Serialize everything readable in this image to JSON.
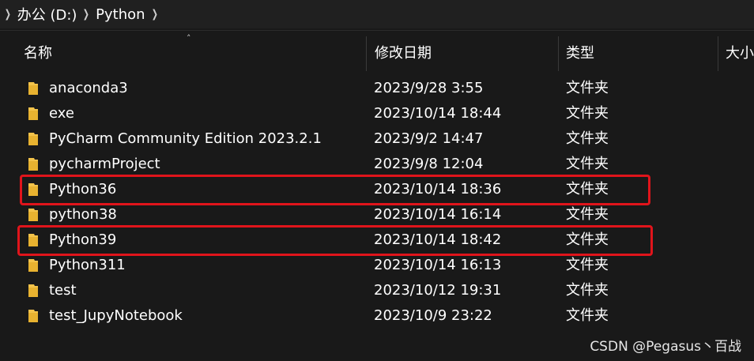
{
  "breadcrumb": {
    "items": [
      "办公 (D:)",
      "Python"
    ]
  },
  "columns": {
    "name": "名称",
    "modified": "修改日期",
    "type": "类型",
    "size": "大小"
  },
  "files": [
    {
      "name": "anaconda3",
      "modified": "2023/9/28 3:55",
      "type": "文件夹"
    },
    {
      "name": "exe",
      "modified": "2023/10/14 18:44",
      "type": "文件夹"
    },
    {
      "name": "PyCharm Community Edition 2023.2.1",
      "modified": "2023/9/2 14:47",
      "type": "文件夹"
    },
    {
      "name": "pycharmProject",
      "modified": "2023/9/8 12:04",
      "type": "文件夹"
    },
    {
      "name": "Python36",
      "modified": "2023/10/14 18:36",
      "type": "文件夹"
    },
    {
      "name": "python38",
      "modified": "2023/10/14 16:14",
      "type": "文件夹"
    },
    {
      "name": "Python39",
      "modified": "2023/10/14 18:42",
      "type": "文件夹"
    },
    {
      "name": "Python311",
      "modified": "2023/10/14 16:13",
      "type": "文件夹"
    },
    {
      "name": "test",
      "modified": "2023/10/12 19:31",
      "type": "文件夹"
    },
    {
      "name": "test_JupyNotebook",
      "modified": "2023/10/9 23:22",
      "type": "文件夹"
    }
  ],
  "watermark": "CSDN @Pegasus丶百战",
  "colors": {
    "background": "#191919",
    "highlight": "#e0141b",
    "folder": "#f3c34a"
  }
}
